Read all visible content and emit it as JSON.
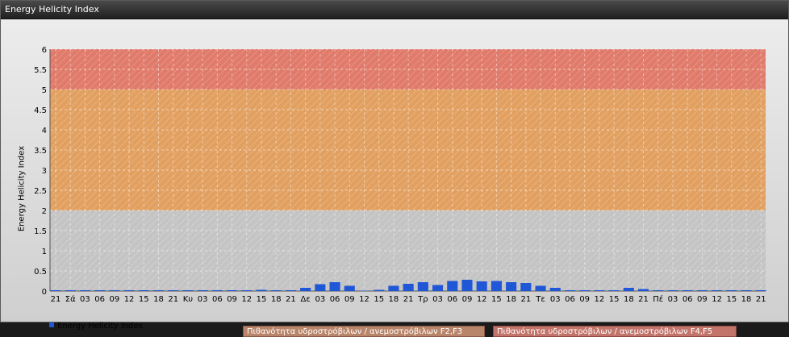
{
  "window": {
    "title": "Energy Helicity Index"
  },
  "chart_data": {
    "type": "bar",
    "ylabel": "Energy Helicity Index",
    "ylim": [
      0,
      6
    ],
    "yticks": [
      "0",
      "0.5",
      "1",
      "1.5",
      "2",
      "2.5",
      "3",
      "3.5",
      "4",
      "4.5",
      "5",
      "5.5",
      "6"
    ],
    "categories": [
      "21",
      "Σά",
      "03",
      "06",
      "09",
      "12",
      "15",
      "18",
      "21",
      "Κυ",
      "03",
      "06",
      "09",
      "12",
      "15",
      "18",
      "21",
      "Δε",
      "03",
      "06",
      "09",
      "12",
      "15",
      "18",
      "21",
      "Τρ",
      "03",
      "06",
      "09",
      "12",
      "15",
      "18",
      "21",
      "Τε",
      "03",
      "06",
      "09",
      "12",
      "15",
      "18",
      "21",
      "Πέ",
      "03",
      "06",
      "09",
      "12",
      "15",
      "18",
      "21"
    ],
    "series": [
      {
        "name": "Energy Helicity Index",
        "color": "#1f57d6",
        "values": [
          0.02,
          0.02,
          0.02,
          0.02,
          0.02,
          0.02,
          0.02,
          0.02,
          0.02,
          0.02,
          0.02,
          0.02,
          0.02,
          0.02,
          0.03,
          0.02,
          0.02,
          0.08,
          0.17,
          0.22,
          0.13,
          0.01,
          0.03,
          0.13,
          0.18,
          0.22,
          0.15,
          0.25,
          0.28,
          0.24,
          0.25,
          0.22,
          0.2,
          0.13,
          0.08,
          0.02,
          0.02,
          0.02,
          0.02,
          0.08,
          0.05,
          0.02,
          0.02,
          0.02,
          0.02,
          0.02,
          0.02,
          0.02,
          0.02
        ]
      }
    ],
    "zones": [
      {
        "from": 2,
        "to": 5,
        "color": "#e2a060",
        "label": "Πιθανότητα υδροστρόβιλων / ανεμοστρόβιλων F2,F3"
      },
      {
        "from": 5,
        "to": 6,
        "color": "#e07a6a",
        "label": "Πιθανότητα υδροστρόβιλων / ανεμοστρόβιλων F4,F5"
      }
    ],
    "grid": true,
    "legend_position": "bottom-left"
  }
}
